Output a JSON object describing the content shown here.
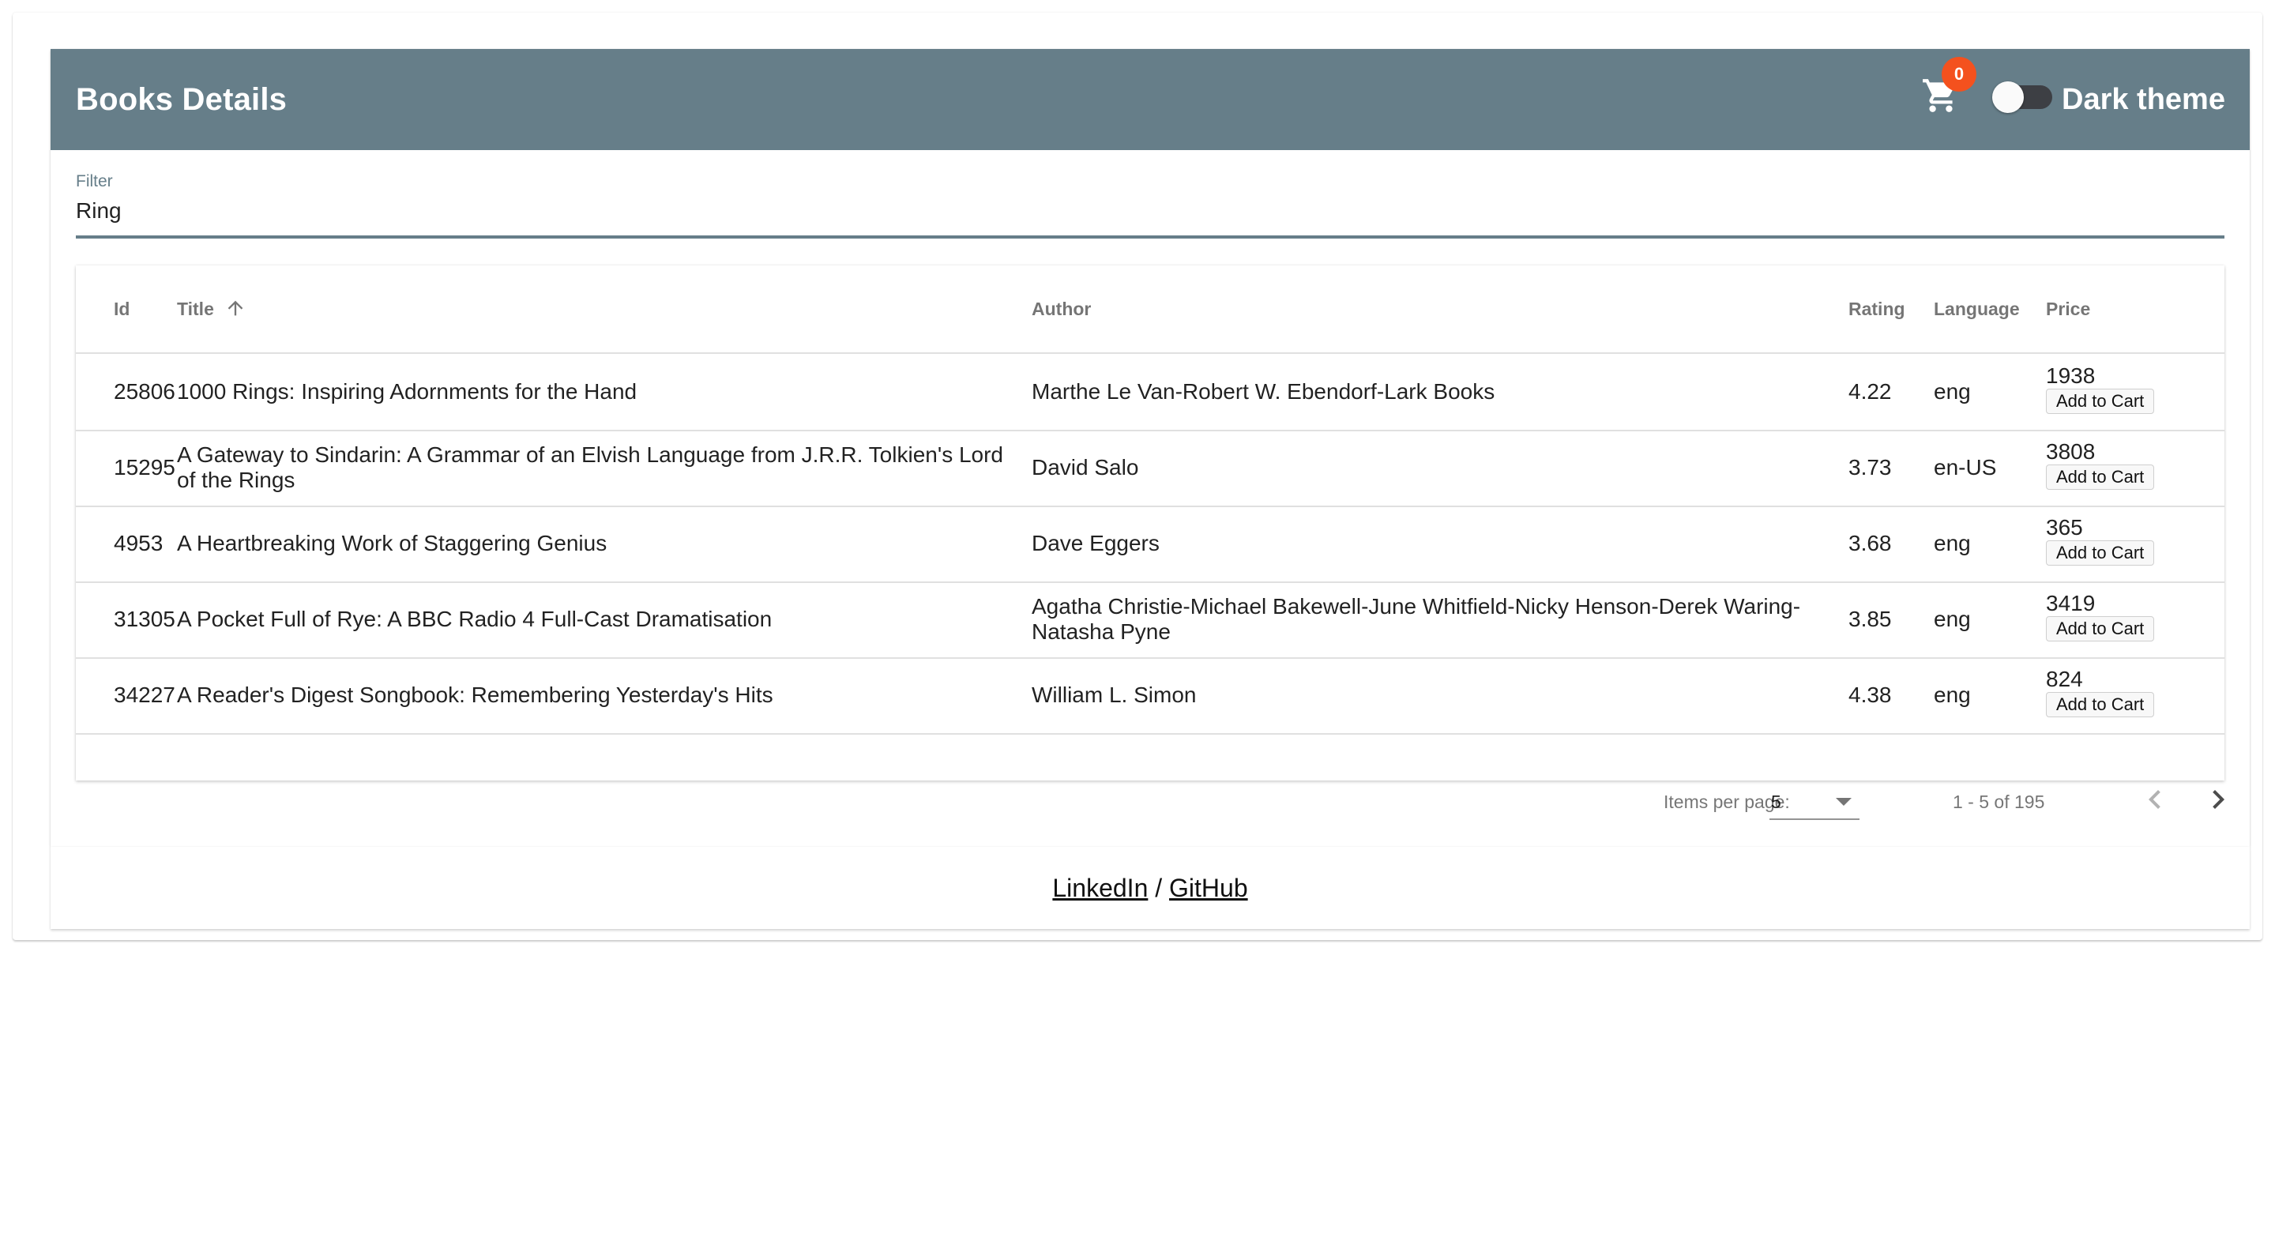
{
  "app": {
    "title": "Books Details"
  },
  "header": {
    "cart_icon": "shopping-cart-icon",
    "cart_count": "0",
    "theme_toggle_label": "Dark theme",
    "theme_toggle_on": false
  },
  "filter": {
    "label": "Filter",
    "value": "Ring"
  },
  "table": {
    "columns": {
      "id": "Id",
      "title": "Title",
      "author": "Author",
      "rating": "Rating",
      "language": "Language",
      "price": "Price"
    },
    "sort": {
      "column": "Title",
      "direction": "ascending",
      "icon": "arrow-up-icon"
    },
    "add_label": "Add to Cart",
    "rows": [
      {
        "id": "25806",
        "title": "1000 Rings: Inspiring Adornments for the Hand",
        "author": "Marthe Le Van-Robert W. Ebendorf-Lark Books",
        "rating": "4.22",
        "language": "eng",
        "price": "1938"
      },
      {
        "id": "15295",
        "title": "A Gateway to Sindarin: A Grammar of an Elvish Language from J.R.R. Tolkien's Lord of the Rings",
        "author": "David Salo",
        "rating": "3.73",
        "language": "en-US",
        "price": "3808"
      },
      {
        "id": "4953",
        "title": "A Heartbreaking Work of Staggering Genius",
        "author": "Dave Eggers",
        "rating": "3.68",
        "language": "eng",
        "price": "365"
      },
      {
        "id": "31305",
        "title": "A Pocket Full of Rye: A BBC Radio 4 Full-Cast Dramatisation",
        "author": "Agatha Christie-Michael Bakewell-June Whitfield-Nicky Henson-Derek Waring-Natasha Pyne",
        "rating": "3.85",
        "language": "eng",
        "price": "3419"
      },
      {
        "id": "34227",
        "title": "A Reader's Digest Songbook: Remembering Yesterday's Hits",
        "author": "William L. Simon",
        "rating": "4.38",
        "language": "eng",
        "price": "824"
      }
    ]
  },
  "paginator": {
    "items_per_page_label": "Items per page:",
    "items_per_page": "5",
    "range": "1 - 5 of 195",
    "prev_icon": "chevron-left-icon",
    "next_icon": "chevron-right-icon"
  },
  "footer": {
    "linkedin": "LinkedIn",
    "separator": "/",
    "github": "GitHub"
  },
  "colors": {
    "toolbar": "#667e89",
    "badge": "#f4511e",
    "toggle_track": "#3d3f44"
  }
}
